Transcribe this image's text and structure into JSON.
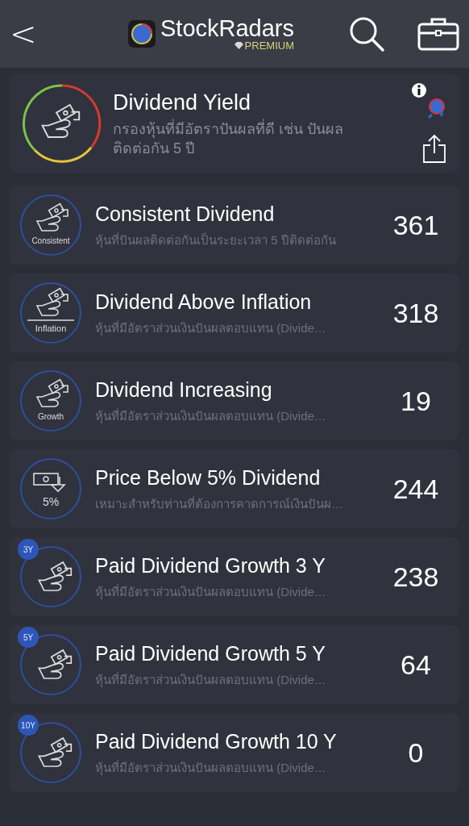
{
  "header": {
    "back": "<",
    "brand": "StockRadars",
    "tier": "PREMIUM"
  },
  "featured": {
    "title": "Dividend Yield",
    "description": "กรองหุ้นที่มีอัตราปันผลที่ดี เช่น ปันผลติดต่อกัน 5 ปี"
  },
  "screeners": [
    {
      "title": "Consistent Dividend",
      "description": "หุ้นที่ปันผลติดต่อกันเป็นระยะเวลา 5 ปีติดต่อกัน",
      "count": "361",
      "icon": {
        "kind": "caption",
        "text": "Consistent"
      }
    },
    {
      "title": "Dividend Above Inflation",
      "description": "หุ้นที่มีอัตราส่วนเงินปันผลตอบแทน (Divide…",
      "count": "318",
      "icon": {
        "kind": "ruled",
        "text": "Inflation"
      }
    },
    {
      "title": "Dividend Increasing",
      "description": "หุ้นที่มีอัตราส่วนเงินปันผลตอบแทน (Divide…",
      "count": "19",
      "icon": {
        "kind": "caption",
        "text": "Growth"
      }
    },
    {
      "title": "Price Below 5% Dividend",
      "description": "เหมาะสำหรับท่านที่ต้องการคาดการณ์เงินปันผ…",
      "count": "244",
      "icon": {
        "kind": "price",
        "text": "5%"
      }
    },
    {
      "title": "Paid Dividend Growth 3 Y",
      "description": "หุ้นที่มีอัตราส่วนเงินปันผลตอบแทน (Divide…",
      "count": "238",
      "icon": {
        "kind": "badge",
        "text": "3Y"
      }
    },
    {
      "title": "Paid Dividend Growth 5 Y",
      "description": "หุ้นที่มีอัตราส่วนเงินปันผลตอบแทน (Divide…",
      "count": "64",
      "icon": {
        "kind": "badge",
        "text": "5Y"
      }
    },
    {
      "title": "Paid Dividend Growth 10 Y",
      "description": "หุ้นที่มีอัตราส่วนเงินปันผลตอบแทน (Divide…",
      "count": "0",
      "icon": {
        "kind": "badge",
        "text": "10Y"
      }
    }
  ]
}
